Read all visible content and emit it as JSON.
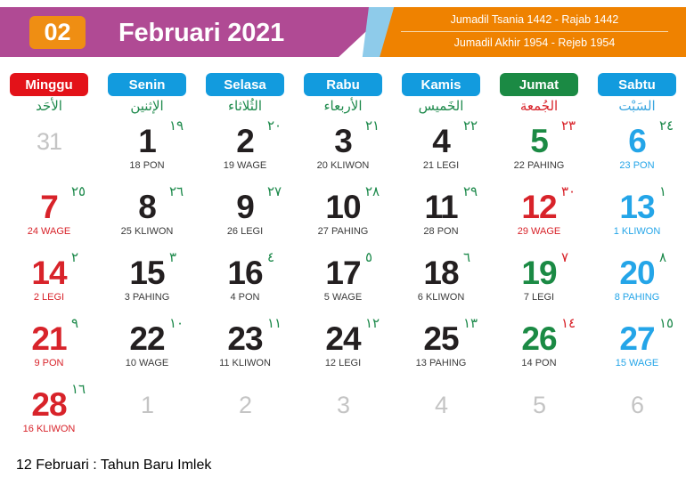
{
  "header": {
    "month_number": "02",
    "title": "Februari 2021",
    "hijri_line_1": "Jumadil Tsania 1442 - Rajab 1442",
    "hijri_line_2": "Jumadil Akhir 1954 - Rejeb 1954",
    "colors": {
      "purple": "#b04a94",
      "orange": "#ef8200",
      "light_blue": "#8ecbea",
      "badge_orange": "#ef8e13"
    }
  },
  "weekdays": [
    {
      "label": "Minggu",
      "arabic": "الأحَد",
      "pill_color": "#e31219",
      "arabic_color": "#1e8a4c"
    },
    {
      "label": "Senin",
      "arabic": "الإثنين",
      "pill_color": "#129bde",
      "arabic_color": "#1e8a4c"
    },
    {
      "label": "Selasa",
      "arabic": "الثُلاثاء",
      "pill_color": "#129bde",
      "arabic_color": "#1e8a4c"
    },
    {
      "label": "Rabu",
      "arabic": "الأربعاء",
      "pill_color": "#129bde",
      "arabic_color": "#1e8a4c"
    },
    {
      "label": "Kamis",
      "arabic": "الخَميس",
      "pill_color": "#129bde",
      "arabic_color": "#1e8a4c"
    },
    {
      "label": "Jumat",
      "arabic": "الجُمعة",
      "pill_color": "#1b8a44",
      "arabic_color": "#d8232a"
    },
    {
      "label": "Sabtu",
      "arabic": "السَبْت",
      "pill_color": "#129bde",
      "arabic_color": "#3aa6e0"
    }
  ],
  "colors": {
    "weekday_black": "#231f20",
    "sunday_red": "#d8232a",
    "friday_green": "#1b8a44",
    "saturday_blue": "#24a5e8",
    "hijri_green": "#1e8a4c",
    "hijri_red": "#d8232a",
    "outside_gray": "#c4c4c4",
    "footer_red": "#d8232a"
  },
  "days": [
    {
      "num": "31",
      "hijri": "",
      "pasaran": "",
      "type": "out"
    },
    {
      "num": "1",
      "hijri": "١٩",
      "pasaran": "18 PON",
      "type": "weekday"
    },
    {
      "num": "2",
      "hijri": "٢٠",
      "pasaran": "19 WAGE",
      "type": "weekday"
    },
    {
      "num": "3",
      "hijri": "٢١",
      "pasaran": "20 KLIWON",
      "type": "weekday"
    },
    {
      "num": "4",
      "hijri": "٢٢",
      "pasaran": "21 LEGI",
      "type": "weekday"
    },
    {
      "num": "5",
      "hijri": "٢٣",
      "pasaran": "22 PAHING",
      "type": "friday"
    },
    {
      "num": "6",
      "hijri": "٢٤",
      "pasaran": "23 PON",
      "type": "saturday"
    },
    {
      "num": "7",
      "hijri": "٢٥",
      "pasaran": "24 WAGE",
      "type": "sunday"
    },
    {
      "num": "8",
      "hijri": "٢٦",
      "pasaran": "25 KLIWON",
      "type": "weekday"
    },
    {
      "num": "9",
      "hijri": "٢٧",
      "pasaran": "26 LEGI",
      "type": "weekday"
    },
    {
      "num": "10",
      "hijri": "٢٨",
      "pasaran": "27 PAHING",
      "type": "weekday"
    },
    {
      "num": "11",
      "hijri": "٢٩",
      "pasaran": "28 PON",
      "type": "weekday"
    },
    {
      "num": "12",
      "hijri": "٣٠",
      "pasaran": "29 WAGE",
      "type": "holiday"
    },
    {
      "num": "13",
      "hijri": "١",
      "pasaran": "1 KLIWON",
      "type": "saturday"
    },
    {
      "num": "14",
      "hijri": "٢",
      "pasaran": "2 LEGI",
      "type": "sunday"
    },
    {
      "num": "15",
      "hijri": "٣",
      "pasaran": "3 PAHING",
      "type": "weekday"
    },
    {
      "num": "16",
      "hijri": "٤",
      "pasaran": "4 PON",
      "type": "weekday"
    },
    {
      "num": "17",
      "hijri": "٥",
      "pasaran": "5 WAGE",
      "type": "weekday"
    },
    {
      "num": "18",
      "hijri": "٦",
      "pasaran": "6 KLIWON",
      "type": "weekday"
    },
    {
      "num": "19",
      "hijri": "٧",
      "pasaran": "7 LEGI",
      "type": "friday"
    },
    {
      "num": "20",
      "hijri": "٨",
      "pasaran": "8 PAHING",
      "type": "saturday"
    },
    {
      "num": "21",
      "hijri": "٩",
      "pasaran": "9 PON",
      "type": "sunday"
    },
    {
      "num": "22",
      "hijri": "١٠",
      "pasaran": "10 WAGE",
      "type": "weekday"
    },
    {
      "num": "23",
      "hijri": "١١",
      "pasaran": "11 KLIWON",
      "type": "weekday"
    },
    {
      "num": "24",
      "hijri": "١٢",
      "pasaran": "12 LEGI",
      "type": "weekday"
    },
    {
      "num": "25",
      "hijri": "١٣",
      "pasaran": "13 PAHING",
      "type": "weekday"
    },
    {
      "num": "26",
      "hijri": "١٤",
      "pasaran": "14 PON",
      "type": "friday"
    },
    {
      "num": "27",
      "hijri": "١٥",
      "pasaran": "15 WAGE",
      "type": "saturday"
    },
    {
      "num": "28",
      "hijri": "١٦",
      "pasaran": "16 KLIWON",
      "type": "sunday"
    },
    {
      "num": "1",
      "hijri": "",
      "pasaran": "",
      "type": "out"
    },
    {
      "num": "2",
      "hijri": "",
      "pasaran": "",
      "type": "out"
    },
    {
      "num": "3",
      "hijri": "",
      "pasaran": "",
      "type": "out"
    },
    {
      "num": "4",
      "hijri": "",
      "pasaran": "",
      "type": "out"
    },
    {
      "num": "5",
      "hijri": "",
      "pasaran": "",
      "type": "out"
    },
    {
      "num": "6",
      "hijri": "",
      "pasaran": "",
      "type": "out"
    }
  ],
  "footer": {
    "note": "12 Februari : Tahun Baru Imlek"
  }
}
